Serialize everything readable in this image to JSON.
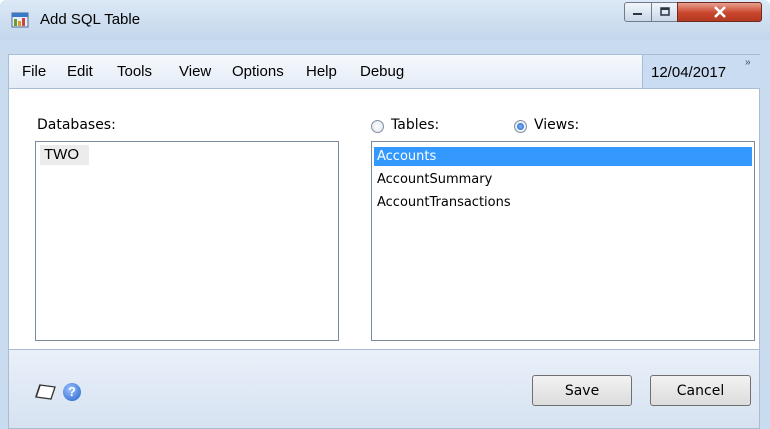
{
  "window": {
    "title": "Add SQL Table",
    "icons": {
      "app": "sql-table-app-icon",
      "minimize": "minimize-icon",
      "maximize": "maximize-icon",
      "close": "close-icon"
    }
  },
  "menu": {
    "items": [
      "File",
      "Edit",
      "Tools",
      "View",
      "Options",
      "Help",
      "Debug"
    ],
    "date": "12/04/2017",
    "overflow": "»"
  },
  "databases": {
    "label": "Databases:",
    "items": [
      "TWO"
    ]
  },
  "source": {
    "tables_label": "Tables:",
    "views_label": "Views:",
    "selected": "Views"
  },
  "views": {
    "items": [
      "Accounts",
      "AccountSummary",
      "AccountTransactions"
    ],
    "selected_index": 0
  },
  "footer": {
    "save_label": "Save",
    "cancel_label": "Cancel",
    "help_glyph": "?",
    "icons": [
      "note-icon",
      "help-icon"
    ]
  },
  "colors": {
    "selection": "#3399ff",
    "frame": "#c9dcef",
    "close_button": "#c9452c"
  }
}
